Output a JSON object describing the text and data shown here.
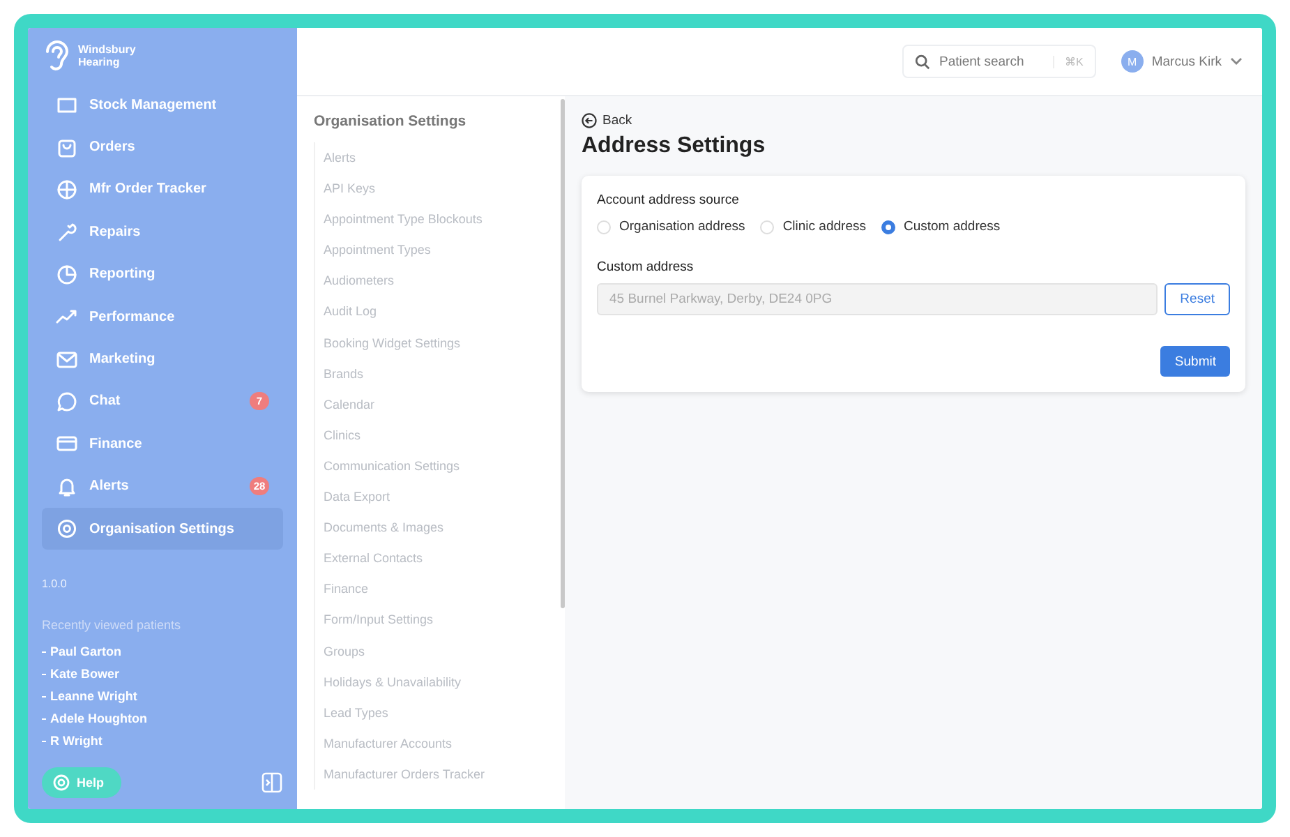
{
  "brand": {
    "line1": "Windsbury",
    "line2": "Hearing"
  },
  "sidebar": {
    "items": [
      {
        "label": "Stock Management",
        "selected": false
      },
      {
        "label": "Orders",
        "selected": false
      },
      {
        "label": "Mfr Order Tracker",
        "selected": false
      },
      {
        "label": "Repairs",
        "selected": false
      },
      {
        "label": "Reporting",
        "selected": false
      },
      {
        "label": "Performance",
        "selected": false
      },
      {
        "label": "Marketing",
        "selected": false
      },
      {
        "label": "Chat",
        "badge": "7",
        "selected": false
      },
      {
        "label": "Finance",
        "selected": false
      },
      {
        "label": "Alerts",
        "badge": "28",
        "selected": false
      },
      {
        "label": "Organisation Settings",
        "selected": true
      }
    ],
    "version": "1.0.0",
    "recent_title": "Recently viewed patients",
    "recent": [
      "Paul Garton",
      "Kate Bower",
      "Leanne Wright",
      "Adele Houghton",
      "R Wright"
    ],
    "help": "Help"
  },
  "settings_menu": {
    "title": "Organisation Settings",
    "items": [
      "Alerts",
      "API Keys",
      "Appointment Type Blockouts",
      "Appointment Types",
      "Audiometers",
      "Audit Log",
      "Booking Widget Settings",
      "Brands",
      "Calendar",
      "Clinics",
      "Communication Settings",
      "Data Export",
      "Documents & Images",
      "External Contacts",
      "Finance",
      "Form/Input Settings",
      "Groups",
      "Holidays & Unavailability",
      "Lead Types",
      "Manufacturer Accounts",
      "Manufacturer Orders Tracker"
    ]
  },
  "topbar": {
    "search_placeholder": "Patient search",
    "shortcut": "⌘K",
    "avatar_initial": "M",
    "user": "Marcus Kirk"
  },
  "page": {
    "back": "Back",
    "title": "Address Settings",
    "source_label": "Account address source",
    "options": [
      {
        "label": "Organisation address",
        "selected": false
      },
      {
        "label": "Clinic address",
        "selected": false
      },
      {
        "label": "Custom address",
        "selected": true
      }
    ],
    "custom_label": "Custom address",
    "custom_value": "45 Burnel Parkway, Derby, DE24 0PG",
    "reset": "Reset",
    "submit": "Submit"
  }
}
